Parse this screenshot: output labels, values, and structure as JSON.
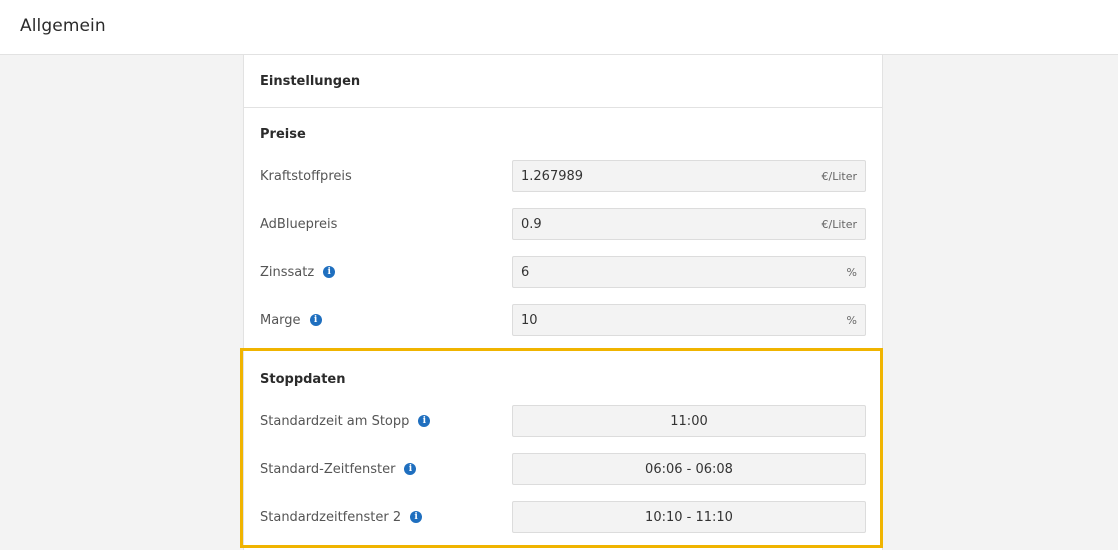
{
  "header": {
    "title": "Allgemein"
  },
  "card": {
    "title": "Einstellungen"
  },
  "prices": {
    "title": "Preise",
    "rows": [
      {
        "label": "Kraftstoffpreis",
        "value": "1.267989",
        "unit": "€/Liter",
        "info": false
      },
      {
        "label": "AdBluepreis",
        "value": "0.9",
        "unit": "€/Liter",
        "info": false
      },
      {
        "label": "Zinssatz",
        "value": "6",
        "unit": "%",
        "info": true
      },
      {
        "label": "Marge",
        "value": "10",
        "unit": "%",
        "info": true
      }
    ]
  },
  "stops": {
    "title": "Stoppdaten",
    "rows": [
      {
        "label": "Standardzeit am Stopp",
        "value": "11:00",
        "info": true
      },
      {
        "label": "Standard-Zeitfenster",
        "value": "06:06 - 06:08",
        "info": true
      },
      {
        "label": "Standardzeitfenster 2",
        "value": "10:10 - 11:10",
        "info": true
      }
    ]
  },
  "colors": {
    "highlight": "#f0b400",
    "info_icon": "#1f6fbf"
  },
  "icons": {
    "info": "info-icon"
  },
  "info_glyph": "i"
}
